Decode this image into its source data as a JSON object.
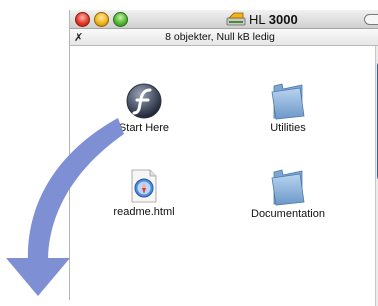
{
  "window": {
    "title_prefix": "HL",
    "title_bold": "3000",
    "status_text": "8 objekter, Null kB ledig"
  },
  "items": [
    {
      "label": "Start Here",
      "icon": "flash-icon"
    },
    {
      "label": "Utilities",
      "icon": "folder-icon"
    },
    {
      "label": "readme.html",
      "icon": "safari-html-icon"
    },
    {
      "label": "Documentation",
      "icon": "folder-icon"
    }
  ],
  "colors": {
    "arrow": "#7e8fd4",
    "folder": "#8fb5dd",
    "close": "#e23b2b",
    "minimize": "#f0b51e",
    "zoom": "#55b634"
  }
}
